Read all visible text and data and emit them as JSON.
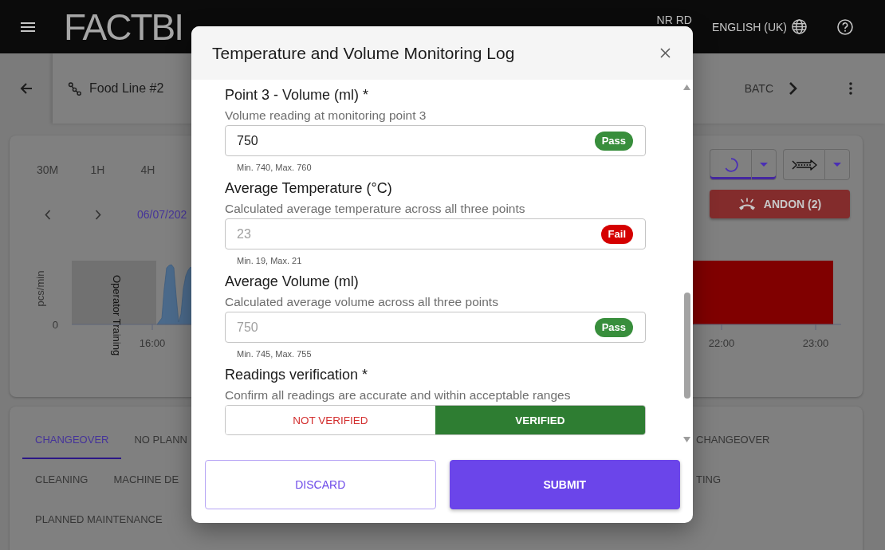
{
  "top_bar": {
    "logo": "FACTBI",
    "user": "NR RD",
    "language": "ENGLISH (UK)"
  },
  "line_header": {
    "line_name": "Food Line #2",
    "tab": "BATC"
  },
  "chart_panel": {
    "time_ranges": [
      {
        "label": "30M",
        "selected": false
      },
      {
        "label": "1H",
        "selected": false
      },
      {
        "label": "4H",
        "selected": false
      }
    ],
    "date": "06/07/202",
    "view_toggles": [
      {
        "kind": "spinner",
        "selected": true
      },
      {
        "kind": "conveyor",
        "selected": false
      }
    ],
    "andon_button": "ANDON (2)",
    "chart": {
      "ylabel": "pcs/min",
      "y_zero": "0",
      "band_label": "Operator Training",
      "x_ticks": [
        "16:00",
        "22:00",
        "23:00"
      ]
    }
  },
  "stop_reasons": {
    "rows": [
      [
        {
          "label": "CHANGEOVER",
          "selected": true
        },
        {
          "label": "NO PLANN",
          "selected": false
        },
        {
          "label": "CHANGEOVER",
          "selected": false
        }
      ],
      [
        {
          "label": "CLEANING",
          "selected": false
        },
        {
          "label": "MACHINE DE",
          "selected": false
        },
        {
          "label": "TING",
          "selected": false
        }
      ],
      [
        {
          "label": "PLANNED MAINTENANCE",
          "selected": false
        }
      ]
    ]
  },
  "dialog": {
    "title": "Temperature and Volume Monitoring Log",
    "fields": [
      {
        "kind": "number",
        "label": "Point 3 - Volume (ml) *",
        "description": "Volume reading at monitoring point 3",
        "value": "750",
        "disabled": false,
        "result": {
          "label": "Pass",
          "kind": "pass"
        },
        "range": "Min. 740, Max. 760"
      },
      {
        "kind": "number",
        "label": "Average Temperature (°C)",
        "description": "Calculated average temperature across all three points",
        "value": "23",
        "disabled": true,
        "result": {
          "label": "Fail",
          "kind": "fail"
        },
        "range": "Min. 19, Max. 21"
      },
      {
        "kind": "number",
        "label": "Average Volume (ml)",
        "description": "Calculated average volume across all three points",
        "value": "750",
        "disabled": true,
        "result": {
          "label": "Pass",
          "kind": "pass"
        },
        "range": "Min. 745, Max. 755"
      },
      {
        "kind": "toggle",
        "label": "Readings verification *",
        "description": "Confirm all readings are accurate and within acceptable ranges",
        "options": [
          {
            "label": "NOT VERIFIED",
            "kind": "negative",
            "selected": false
          },
          {
            "label": "VERIFIED",
            "kind": "positive",
            "selected": true
          }
        ]
      }
    ],
    "buttons": [
      {
        "label": "DISCARD",
        "kind": "secondary"
      },
      {
        "label": "SUBMIT",
        "kind": "primary"
      }
    ]
  }
}
